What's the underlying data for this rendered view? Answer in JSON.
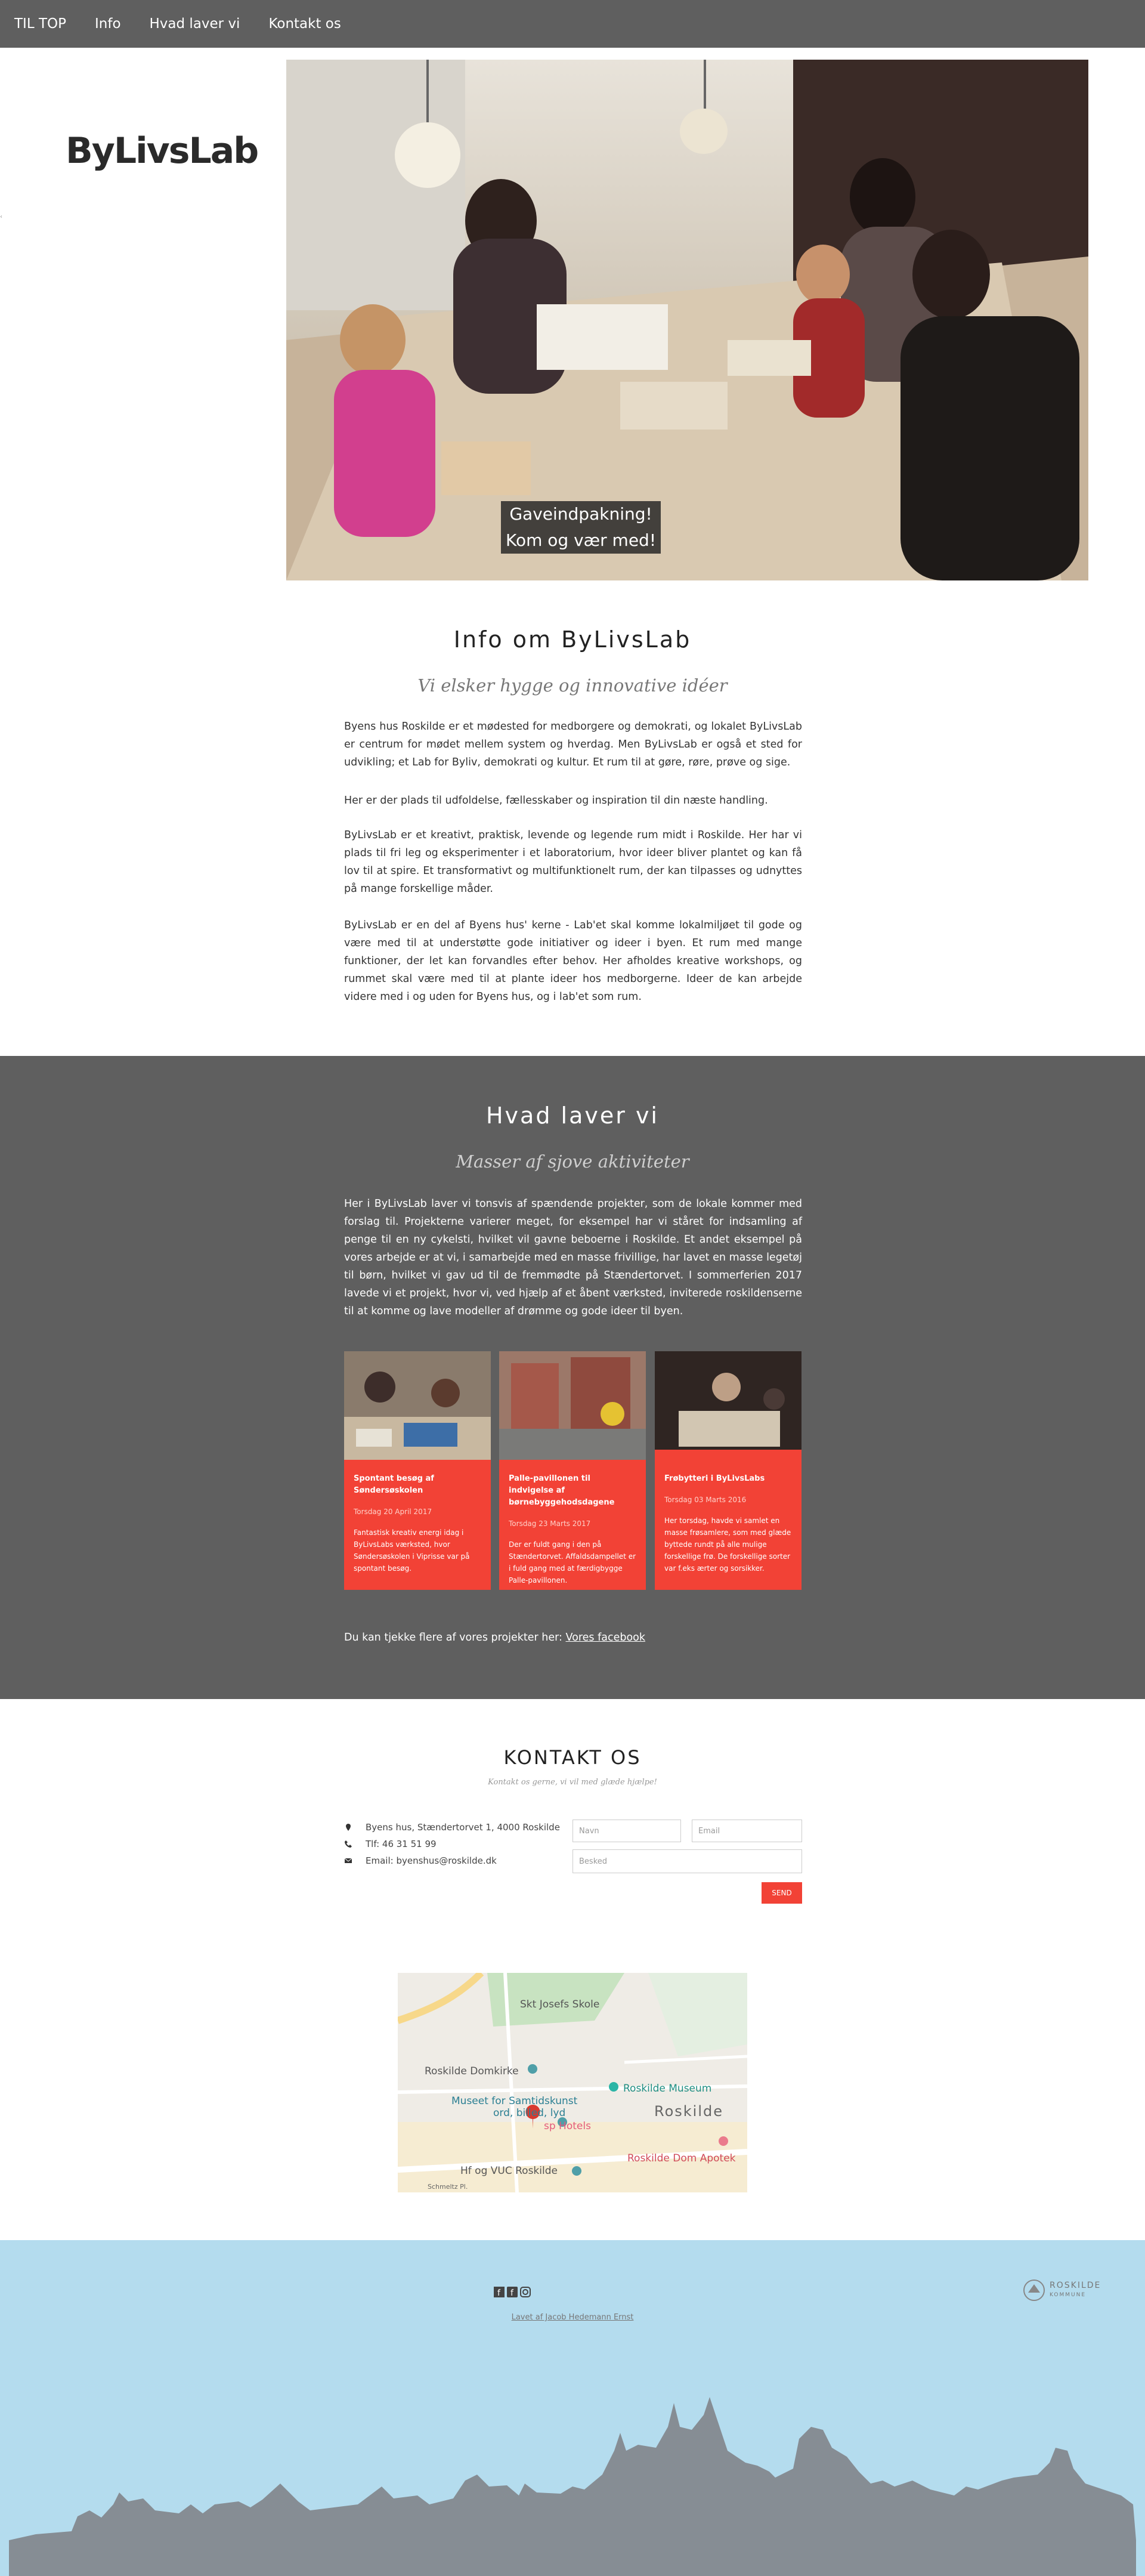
{
  "nav": {
    "items": [
      "TIL TOP",
      "Info",
      "Hvad laver vi",
      "Kontakt os"
    ]
  },
  "logo": {
    "text": "ByLivsLab"
  },
  "hero": {
    "caption_line1": "Gaveindpakning!",
    "caption_line2": "Kom og vær med!"
  },
  "info": {
    "title": "Info om ByLivsLab",
    "subtitle": "Vi elsker hygge og innovative idéer",
    "paragraphs": [
      "Byens hus Roskilde er et mødested for medborgere og demokrati, og lokalet ByLivsLab er centrum for mødet mellem system og hverdag. Men ByLivsLab er også et sted for udvikling; et Lab for Byliv, demokrati og kultur. Et rum til at gøre, røre, prøve og sige.",
      "Her er der plads til udfoldelse, fællesskaber og inspiration til din næste handling.",
      "ByLivsLab er et kreativt, praktisk, levende og legende rum midt i Roskilde. Her har vi plads til fri leg og eksperimenter i et laboratorium, hvor ideer bliver plantet og kan få lov til at spire. Et transformativt og multifunktionelt rum, der kan tilpasses og udnyttes på mange forskellige måder.",
      "ByLivsLab er en del af Byens hus' kerne - Lab'et skal komme lokalmiljøet til gode og være med til at understøtte gode initiativer og ideer i byen. Et rum med mange funktioner, der let kan forvandles efter behov. Her afholdes kreative workshops, og rummet skal være med til at plante ideer hos medborgerne. Ideer de kan arbejde videre med i og uden for Byens hus, og i lab'et som rum."
    ]
  },
  "activities": {
    "title": "Hvad laver vi",
    "subtitle": "Masser af sjove aktiviteter",
    "paragraph": "Her i ByLivsLab laver vi tonsvis af spændende projekter, som de lokale kommer med forslag til. Projekterne varierer meget, for eksempel har vi ståret for indsamling af penge til en ny cykelsti, hvilket vil gavne beboerne i Roskilde. Et andet eksempel på vores arbejde er at vi, i samarbejde med en masse frivillige, har lavet en masse legetøj til børn, hvilket vi gav ud til de fremmødte på Stændertorvet. I sommerferien 2017 lavede vi et projekt, hvor vi, ved hjælp af et åbent værksted, inviterede roskildenserne til at komme og lave modeller af drømme og gode ideer til byen.",
    "cards": [
      {
        "title": "Spontant besøg af Søndersøskolen",
        "date": "Torsdag 20 April 2017",
        "text": "Fantastisk kreativ energi idag i ByLivsLabs værksted, hvor Søndersøskolen i Viprisse var på spontant besøg."
      },
      {
        "title": "Palle-pavillonen til indvigelse af børnebyggehodsdagene",
        "date": "Torsdag 23 Marts 2017",
        "text": "Der er fuldt gang i den på Stændertorvet. Affaldsdampellet er i fuld gang med at færdigbygge Palle-pavillonen."
      },
      {
        "title": "Frøbytteri i ByLivsLabs",
        "date": "Torsdag 03 Marts 2016",
        "text": "Her torsdag, havde vi samlet en masse frøsamlere, som med glæde byttede rundt på alle mulige forskellige frø. De forskellige sorter var f.eks ærter og sorsikker."
      }
    ],
    "more_prefix": "Du kan tjekke flere af vores projekter her:",
    "more_link": "Vores facebook"
  },
  "contact": {
    "title": "KONTAKT OS",
    "subtitle": "Kontakt os gerne, vi vil med glæde hjælpe!",
    "address": "Byens hus, Stændertorvet 1, 4000 Roskilde",
    "phone": "Tlf: 46 31 51 99",
    "email": "Email: byenshus@roskilde.dk",
    "name_placeholder": "Navn",
    "email_placeholder": "Email",
    "message_placeholder": "Besked",
    "send_label": "SEND"
  },
  "map": {
    "labels": {
      "school": "Skt Josefs Skole",
      "cathedral": "Roskilde Domkirke",
      "museum": "Roskilde Museum",
      "samtidskunst": "Museet for Samtidskunst",
      "samtidskunst2": "ord, billed, lyd",
      "hotels": "sp Hotels",
      "city": "Roskilde",
      "vuc": "Hf og VUC Roskilde",
      "apotek": "Roskilde Dom Apotek",
      "street": "Schmeltz Pl."
    }
  },
  "footer": {
    "credit": "Lavet af Jacob Hedemann Ernst",
    "kommune_top": "ROSKILDE",
    "kommune_bottom": "KOMMUNE"
  },
  "colors": {
    "nav_bg": "#5f5f5f",
    "accent": "#f24236",
    "footer_bg": "#b4dcee",
    "skyline": "#868d94"
  }
}
